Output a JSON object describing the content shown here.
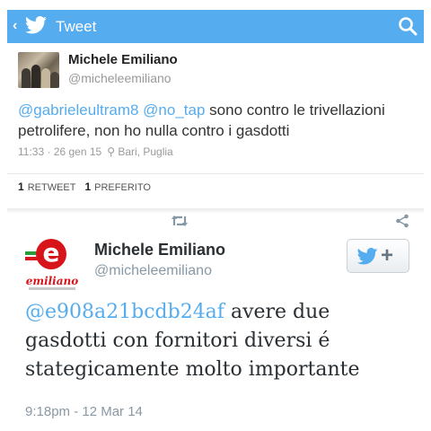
{
  "app_bar": {
    "back_glyph": "‹",
    "title": "Tweet",
    "bird_icon": "twitter-bird-icon",
    "search_icon": "search-icon",
    "color": "#55acee"
  },
  "tweet1": {
    "author_name": "Michele Emiliano",
    "author_handle": "@micheleemiliano",
    "mention_1": "@gabrieleultram8",
    "mention_2": "@no_tap",
    "text_after_mentions": " sono contro le trivellazioni petrolifere, non ho nulla contro i gasdotti",
    "timestamp": "11:33 · 26 gen 15",
    "location_glyph": "⚲",
    "location": "Bari, Puglia",
    "retweet_count": "1",
    "retweet_label": "RETWEET",
    "favorite_count": "1",
    "favorite_label": "PREFERITO"
  },
  "tweet2": {
    "retweet_icon": "retweet-icon",
    "share_icon": "share-icon",
    "author_name": "Michele Emiliano",
    "author_handle": "@micheleemiliano",
    "follow_plus": "+",
    "mention": "@e908a21bcdb24af",
    "text_after_mention": " avere due gasdotti con fornitori diversi é stategicamente molto importante",
    "timestamp": "9:18pm - 12 Mar 14",
    "logo_letter": "e",
    "logo_word": "emiliano"
  },
  "colors": {
    "twitter_blue": "#55acee",
    "logo_red": "#d7141a",
    "logo_green": "#2a9a3a",
    "muted_text": "#8899a6"
  }
}
